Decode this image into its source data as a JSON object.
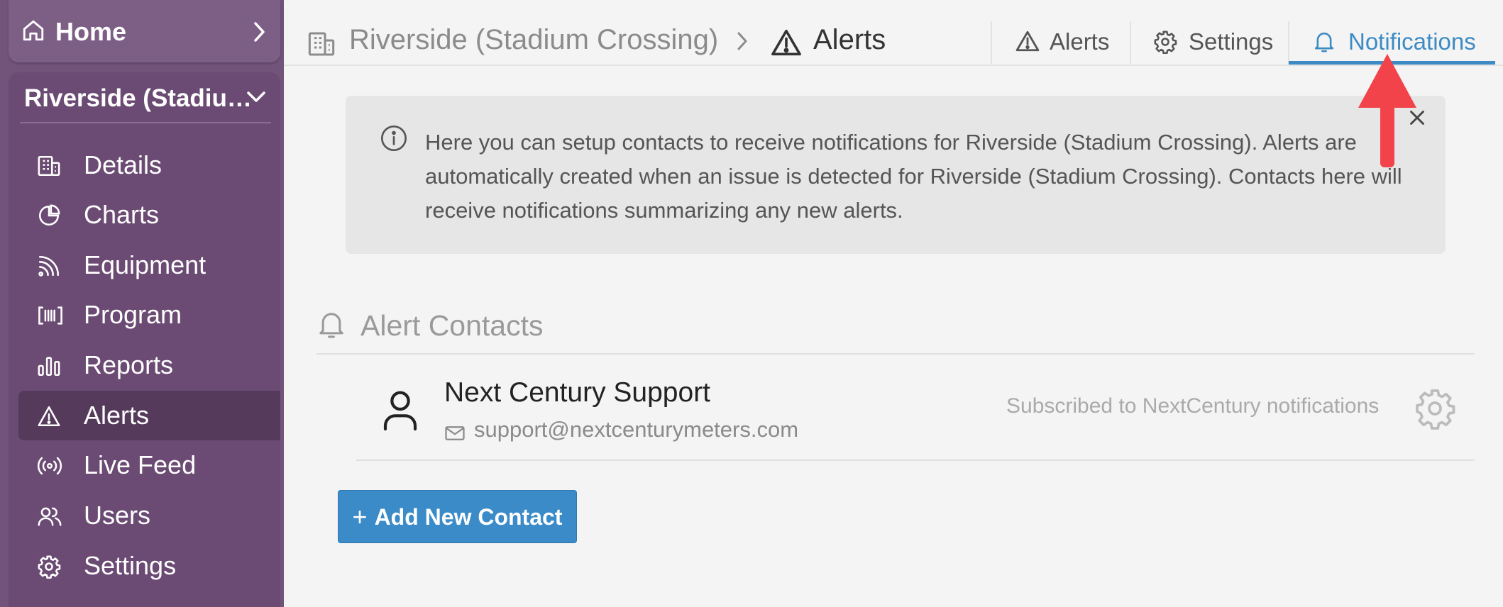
{
  "sidebar": {
    "home_label": "Home",
    "site_name": "Riverside (Stadiu…",
    "items": [
      {
        "label": "Details",
        "icon": "building-icon"
      },
      {
        "label": "Charts",
        "icon": "pie-chart-icon"
      },
      {
        "label": "Equipment",
        "icon": "signal-icon"
      },
      {
        "label": "Program",
        "icon": "barcode-icon"
      },
      {
        "label": "Reports",
        "icon": "bar-chart-icon"
      },
      {
        "label": "Alerts",
        "icon": "warning-icon",
        "active": true
      },
      {
        "label": "Live Feed",
        "icon": "broadcast-icon"
      },
      {
        "label": "Users",
        "icon": "users-icon"
      },
      {
        "label": "Settings",
        "icon": "gear-icon"
      }
    ]
  },
  "breadcrumb": {
    "site": "Riverside (Stadium Crossing)",
    "current": "Alerts"
  },
  "tabs": [
    {
      "label": "Alerts",
      "icon": "warning-icon"
    },
    {
      "label": "Settings",
      "icon": "gear-icon"
    },
    {
      "label": "Notifications",
      "icon": "bell-icon",
      "active": true
    }
  ],
  "info": {
    "text": "Here you can setup contacts to receive notifications for Riverside (Stadium Crossing). Alerts are automatically created when an issue is detected for Riverside (Stadium Crossing). Contacts here will receive notifications summarizing any new alerts."
  },
  "contacts_section": {
    "title": "Alert Contacts",
    "contacts": [
      {
        "name": "Next Century Support",
        "email": "support@nextcenturymeters.com",
        "subscription": "Subscribed to NextCentury notifications"
      }
    ],
    "add_button_label": "Add New Contact"
  },
  "colors": {
    "sidebar": "#72537a",
    "accent": "#3d8bc4",
    "annotation": "#f2434b"
  }
}
